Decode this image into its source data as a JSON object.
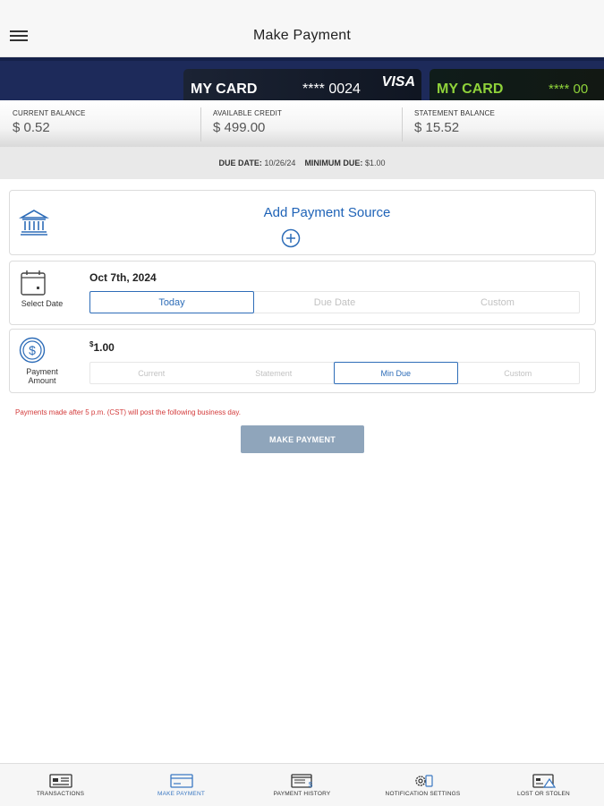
{
  "header": {
    "title": "Make Payment"
  },
  "cards": [
    {
      "name": "MY CARD",
      "number": "**** 0024",
      "brand": "VISA"
    },
    {
      "name": "MY CARD",
      "number": "**** 00"
    }
  ],
  "balances": {
    "current": {
      "label": "CURRENT BALANCE",
      "value": "$ 0.52"
    },
    "available": {
      "label": "AVAILABLE CREDIT",
      "value": "$ 499.00"
    },
    "statement": {
      "label": "STATEMENT BALANCE",
      "value": "$ 15.52"
    }
  },
  "due": {
    "date_label": "DUE DATE:",
    "date_value": "10/26/24",
    "min_label": "MINIMUM DUE:",
    "min_value": "$1.00"
  },
  "payment_source": {
    "label": "Add Payment Source"
  },
  "select_date": {
    "label": "Select Date",
    "value": "Oct 7th, 2024",
    "options": [
      "Today",
      "Due Date",
      "Custom"
    ],
    "selected": "Today"
  },
  "payment_amount": {
    "label_line1": "Payment",
    "label_line2": "Amount",
    "currency": "$",
    "value": "1.00",
    "options": [
      "Current",
      "Statement",
      "Min Due",
      "Custom"
    ],
    "selected": "Min Due"
  },
  "notice": "Payments made after 5 p.m. (CST) will post the following business day.",
  "make_payment_button": "MAKE PAYMENT",
  "tabs": [
    {
      "label": "TRANSACTIONS",
      "icon": "card-list-icon",
      "active": false
    },
    {
      "label": "MAKE PAYMENT",
      "icon": "card-payment-icon",
      "active": true
    },
    {
      "label": "PAYMENT HISTORY",
      "icon": "calendar-dollar-icon",
      "active": false
    },
    {
      "label": "NOTIFICATION SETTINGS",
      "icon": "gear-phone-icon",
      "active": false
    },
    {
      "label": "LOST OR STOLEN",
      "icon": "card-alert-icon",
      "active": false
    }
  ],
  "colors": {
    "accent": "#2e6db8",
    "banner": "#1d2a5a",
    "notice": "#d33b3b",
    "button": "#8fa5bb",
    "card2_text": "#8fd23a"
  }
}
